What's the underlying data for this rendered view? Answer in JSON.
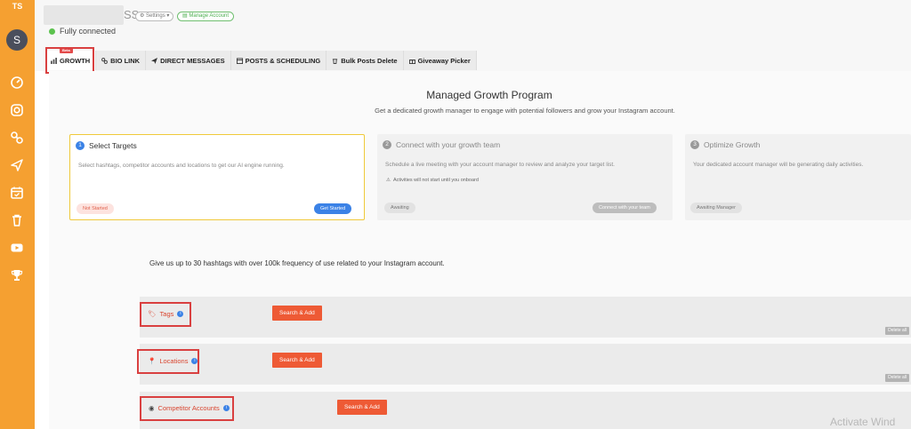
{
  "sidebar": {
    "initials": "TS",
    "avatar_letter": "S",
    "icons": [
      "dashboard-icon",
      "instagram-icon",
      "link-icon",
      "send-icon",
      "calendar-icon",
      "trash-icon",
      "youtube-icon",
      "trophy-icon"
    ]
  },
  "header": {
    "account_suffix": "SS",
    "settings_chip": "Settings",
    "manage_chip": "Manage Account",
    "status": "Fully connected",
    "status_color": "#5cc24e"
  },
  "tabs": [
    {
      "label": "GROWTH",
      "badge": "Beta"
    },
    {
      "label": "BIO LINK"
    },
    {
      "label": "DIRECT MESSAGES"
    },
    {
      "label": "POSTS & SCHEDULING"
    },
    {
      "label": "Bulk Posts Delete"
    },
    {
      "label": "Giveaway Picker"
    }
  ],
  "program": {
    "title": "Managed Growth Program",
    "subtitle": "Get a dedicated growth manager to engage with potential followers and grow your Instagram account."
  },
  "steps": [
    {
      "num": "1",
      "title": "Select Targets",
      "desc": "Select hashtags, competitor accounts and locations to get our AI engine running.",
      "status": "Not Started",
      "action": "Get Started"
    },
    {
      "num": "2",
      "title": "Connect with your growth team",
      "desc": "Schedule a live meeting with your account manager to review and analyze your target list.",
      "note": "Activities will not start until you onboard",
      "status": "Awaiting",
      "action": "Connect with your team"
    },
    {
      "num": "3",
      "title": "Optimize Growth",
      "desc": "Your dedicated account manager will be generating daily activities.",
      "status": "Awaiting Manager"
    }
  ],
  "instructions": "Give us up to 30 hashtags with over 100k frequency of use related to your Instagram account.",
  "targets": {
    "tags": {
      "label": "Tags",
      "button": "Search & Add",
      "delete": "Delete all"
    },
    "locations": {
      "label": "Locations",
      "button": "Search & Add",
      "delete": "Delete all"
    },
    "competitors": {
      "label": "Competitor Accounts",
      "button": "Search & Add"
    }
  },
  "watermark": "Activate Wind",
  "colors": {
    "sidebar": "#f5a031",
    "accent": "#ee5a35",
    "primary": "#3b82e6",
    "highlight": "#d94040"
  }
}
